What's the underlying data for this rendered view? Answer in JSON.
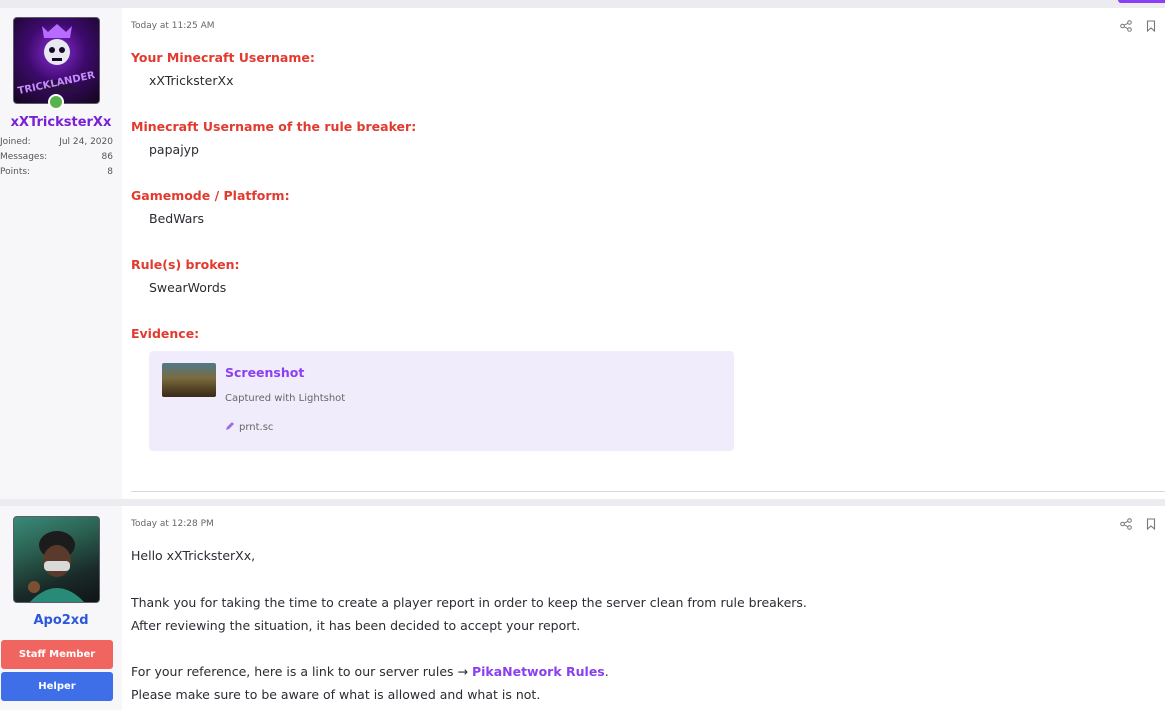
{
  "post1": {
    "author": {
      "username": "xXTricksterXx",
      "stats": [
        {
          "label": "Joined:",
          "value": "Jul 24, 2020"
        },
        {
          "label": "Messages:",
          "value": "86"
        },
        {
          "label": "Points:",
          "value": "8"
        }
      ]
    },
    "timestamp": "Today at 11:25 AM",
    "fields": [
      {
        "label": "Your Minecraft Username:",
        "value": "xXTricksterXx"
      },
      {
        "label": "Minecraft Username of the rule breaker:",
        "value": "papajyp"
      },
      {
        "label": "Gamemode / Platform:",
        "value": "BedWars"
      },
      {
        "label": "Rule(s) broken:",
        "value": "SwearWords"
      },
      {
        "label": "Evidence:",
        "value": ""
      }
    ],
    "embed": {
      "title": "Screenshot",
      "description": "Captured with Lightshot",
      "domain": "prnt.sc"
    }
  },
  "post2": {
    "author": {
      "username": "Apo2xd",
      "badges": [
        "Staff Member",
        "Helper"
      ]
    },
    "timestamp": "Today at 12:28 PM",
    "lines": {
      "greeting": "Hello xXTricksterXx,",
      "l1": "Thank you for taking the time to create a player report in order to keep the server clean from rule breakers.",
      "l2": "After reviewing the situation, it has been decided to accept your report.",
      "l3_prefix": "For your reference, here is a link to our server rules → ",
      "l3_link": "PikaNetwork Rules",
      "l3_suffix": ".",
      "l4": "Please make sure to be aware of what is allowed and what is not."
    }
  },
  "icons": {
    "share": "share-icon",
    "bookmark": "bookmark-icon",
    "link": "pencil-link-icon",
    "online": "online-status-icon"
  },
  "colors": {
    "field_label": "#e23a2e",
    "accent_purple": "#8a3ff2",
    "username_purple": "#7b1fd6",
    "username_blue": "#2c58d9",
    "staff_badge": "#f0655f",
    "helper_badge": "#3e6ee8",
    "embed_bg": "#f1ecfb"
  }
}
